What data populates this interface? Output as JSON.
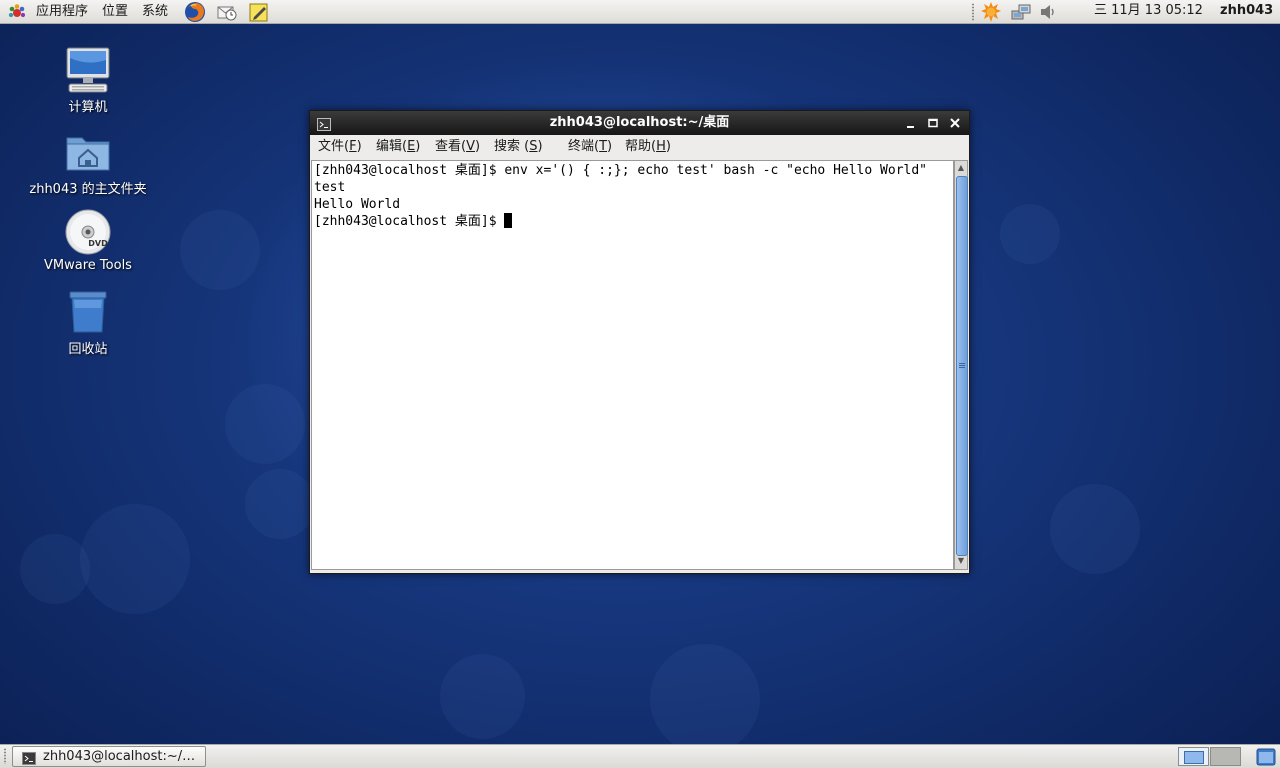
{
  "top_panel": {
    "menus": [
      "应用程序",
      "位置",
      "系统"
    ],
    "clock": "三 11月 13 05:12",
    "user": "zhh043"
  },
  "desktop_icons": [
    {
      "label": "计算机"
    },
    {
      "label": "zhh043 的主文件夹"
    },
    {
      "label": "VMware Tools"
    },
    {
      "label": "回收站"
    }
  ],
  "dvd_badge": "DVD",
  "terminal": {
    "title": "zhh043@localhost:~/桌面",
    "menus": [
      {
        "text": "文件(",
        "key": "F",
        "end": ")"
      },
      {
        "text": "编辑(",
        "key": "E",
        "end": ")"
      },
      {
        "text": "查看(",
        "key": "V",
        "end": ")"
      },
      {
        "text": "搜索 (",
        "key": "S",
        "end": ")"
      },
      {
        "text": "终端(",
        "key": "T",
        "end": ")"
      },
      {
        "text": "帮助(",
        "key": "H",
        "end": ")"
      }
    ],
    "lines": [
      "[zhh043@localhost 桌面]$ env x='() { :;}; echo test' bash -c \"echo Hello World\"",
      "test",
      "Hello World",
      "[zhh043@localhost 桌面]$ "
    ]
  },
  "taskbar": {
    "task_label": "zhh043@localhost:~/…"
  },
  "colors": {
    "desktop": "#153479",
    "titlebar": "#262626",
    "scroll_thumb": "#7faae2"
  }
}
